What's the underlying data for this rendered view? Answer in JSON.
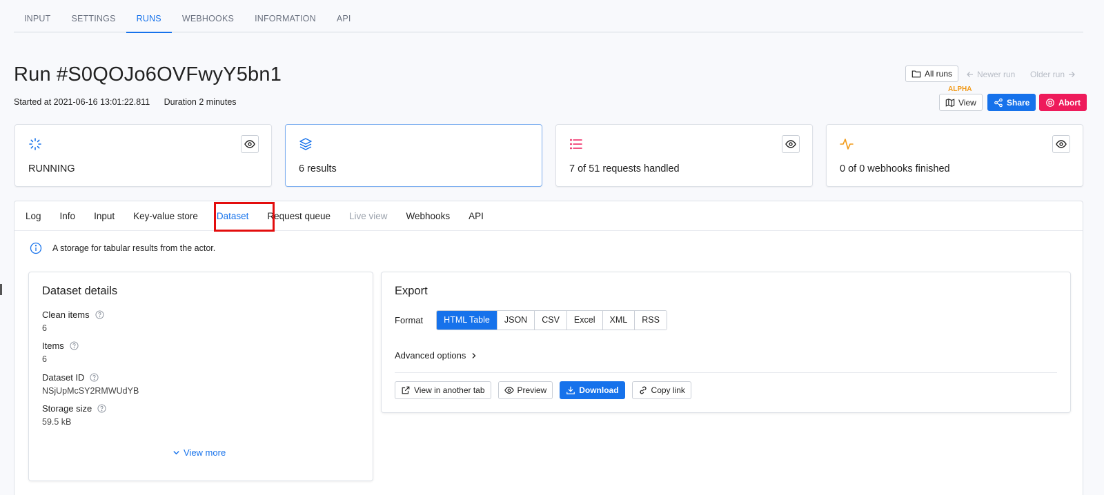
{
  "top_tabs": [
    "INPUT",
    "SETTINGS",
    "RUNS",
    "WEBHOOKS",
    "INFORMATION",
    "API"
  ],
  "top_tabs_active": "RUNS",
  "run": {
    "title": "Run #S0QOJo6OVFwyY5bn1",
    "started": "Started at 2021-06-16 13:01:22.811",
    "duration": "Duration 2 minutes"
  },
  "header_actions": {
    "all_runs": "All runs",
    "newer_run": "Newer run",
    "older_run": "Older run",
    "alpha": "ALPHA",
    "view": "View",
    "share": "Share",
    "abort": "Abort"
  },
  "stats": [
    {
      "icon": "spinner-icon",
      "text": "RUNNING",
      "color": "#1672eb"
    },
    {
      "icon": "layers-icon",
      "text": "6 results",
      "color": "#1672eb"
    },
    {
      "icon": "list-icon",
      "text": "7 of 51 requests handled",
      "color": "#ee1b5b"
    },
    {
      "icon": "activity-icon",
      "text": "0 of 0 webhooks finished",
      "color": "#f19a19"
    }
  ],
  "sub_tabs": [
    "Log",
    "Info",
    "Input",
    "Key-value store",
    "Dataset",
    "Request queue",
    "Live view",
    "Webhooks",
    "API"
  ],
  "sub_tabs_active": "Dataset",
  "info_text": "A storage for tabular results from the actor.",
  "dataset_details": {
    "title": "Dataset details",
    "clean_items_label": "Clean items",
    "clean_items": "6",
    "items_label": "Items",
    "items": "6",
    "dataset_id_label": "Dataset ID",
    "dataset_id": "NSjUpMcSY2RMWUdYB",
    "storage_size_label": "Storage size",
    "storage_size": "59.5 kB",
    "view_more": "View more"
  },
  "export": {
    "title": "Export",
    "format_label": "Format",
    "formats": [
      "HTML Table",
      "JSON",
      "CSV",
      "Excel",
      "XML",
      "RSS"
    ],
    "format_selected": "HTML Table",
    "advanced": "Advanced options",
    "view_tab": "View in another tab",
    "preview": "Preview",
    "download": "Download",
    "copy_link": "Copy link"
  },
  "colors": {
    "accent": "#1672eb",
    "danger": "#ee1b5b",
    "warning": "#f19a19",
    "highlight": "#e30d0d"
  }
}
